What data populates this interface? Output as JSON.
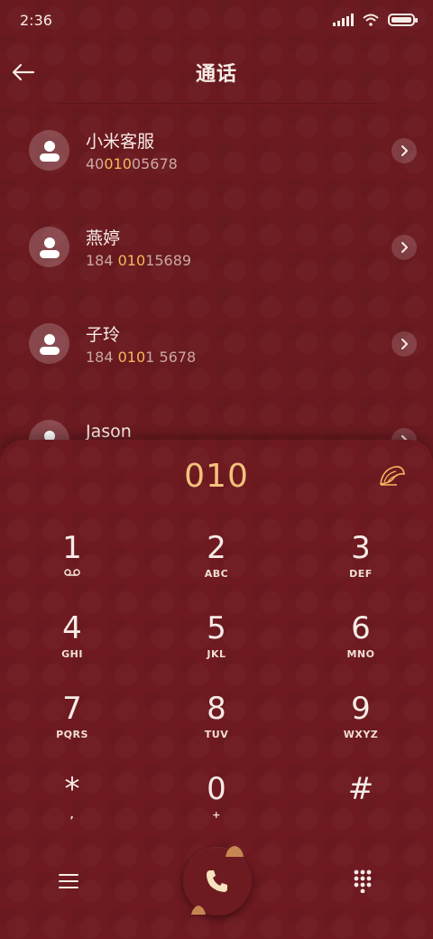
{
  "status_bar": {
    "time": "2:36"
  },
  "header": {
    "title": "通话"
  },
  "contacts": [
    {
      "name": "小米客服",
      "number_parts": [
        "40",
        "010",
        "05678"
      ]
    },
    {
      "name": "燕婷",
      "number_parts": [
        "184 ",
        "010",
        "15689"
      ]
    },
    {
      "name": "子玲",
      "number_parts": [
        "184 ",
        "010",
        "1 5678"
      ]
    },
    {
      "name": "Jason",
      "number_parts": [
        "",
        "",
        ""
      ]
    }
  ],
  "dialpad": {
    "input": "010",
    "keys": [
      {
        "num": "1",
        "sub": "voicemail"
      },
      {
        "num": "2",
        "sub": "ABC"
      },
      {
        "num": "3",
        "sub": "DEF"
      },
      {
        "num": "4",
        "sub": "GHI"
      },
      {
        "num": "5",
        "sub": "JKL"
      },
      {
        "num": "6",
        "sub": "MNO"
      },
      {
        "num": "7",
        "sub": "PQRS"
      },
      {
        "num": "8",
        "sub": "TUV"
      },
      {
        "num": "9",
        "sub": "WXYZ"
      },
      {
        "num": "*",
        "sub": ","
      },
      {
        "num": "0",
        "sub": "+"
      },
      {
        "num": "#",
        "sub": ""
      }
    ]
  },
  "colors": {
    "background": "#6a1a1f",
    "highlight": "#f2b95e",
    "text": "#f6ece6"
  },
  "icons": [
    "back-arrow-icon",
    "person-icon",
    "chevron-right-icon",
    "fan-icon",
    "voicemail-icon",
    "menu-icon",
    "phone-icon",
    "keypad-icon"
  ]
}
